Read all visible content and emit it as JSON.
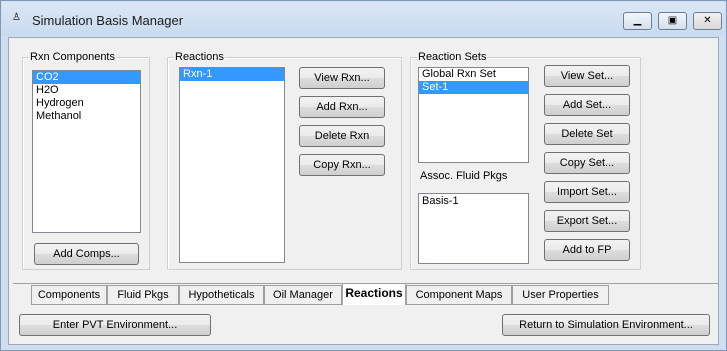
{
  "window": {
    "title": "Simulation Basis Manager"
  },
  "rxn_components": {
    "group_label": "Rxn Components",
    "items": [
      "CO2",
      "H2O",
      "Hydrogen",
      "Methanol"
    ],
    "add_button": "Add Comps..."
  },
  "reactions": {
    "group_label": "Reactions",
    "items": [
      "Rxn-1"
    ],
    "buttons": {
      "view": "View Rxn...",
      "add": "Add Rxn...",
      "delete": "Delete Rxn",
      "copy": "Copy Rxn..."
    }
  },
  "reaction_sets": {
    "group_label": "Reaction Sets",
    "items": [
      "Global Rxn Set",
      "Set-1"
    ],
    "assoc_label": "Assoc. Fluid Pkgs",
    "assoc_items": [
      "Basis-1"
    ],
    "buttons": {
      "view": "View Set...",
      "add": "Add Set...",
      "delete": "Delete Set",
      "copy": "Copy Set...",
      "import": "Import Set...",
      "export": "Export Set...",
      "add_to_fp": "Add to FP"
    }
  },
  "tabs": [
    "Components",
    "Fluid Pkgs",
    "Hypotheticals",
    "Oil Manager",
    "Reactions",
    "Component Maps",
    "User Properties"
  ],
  "active_tab": "Reactions",
  "bottom": {
    "enter_pvt": "Enter PVT Environment...",
    "return_sim": "Return to Simulation Environment..."
  }
}
